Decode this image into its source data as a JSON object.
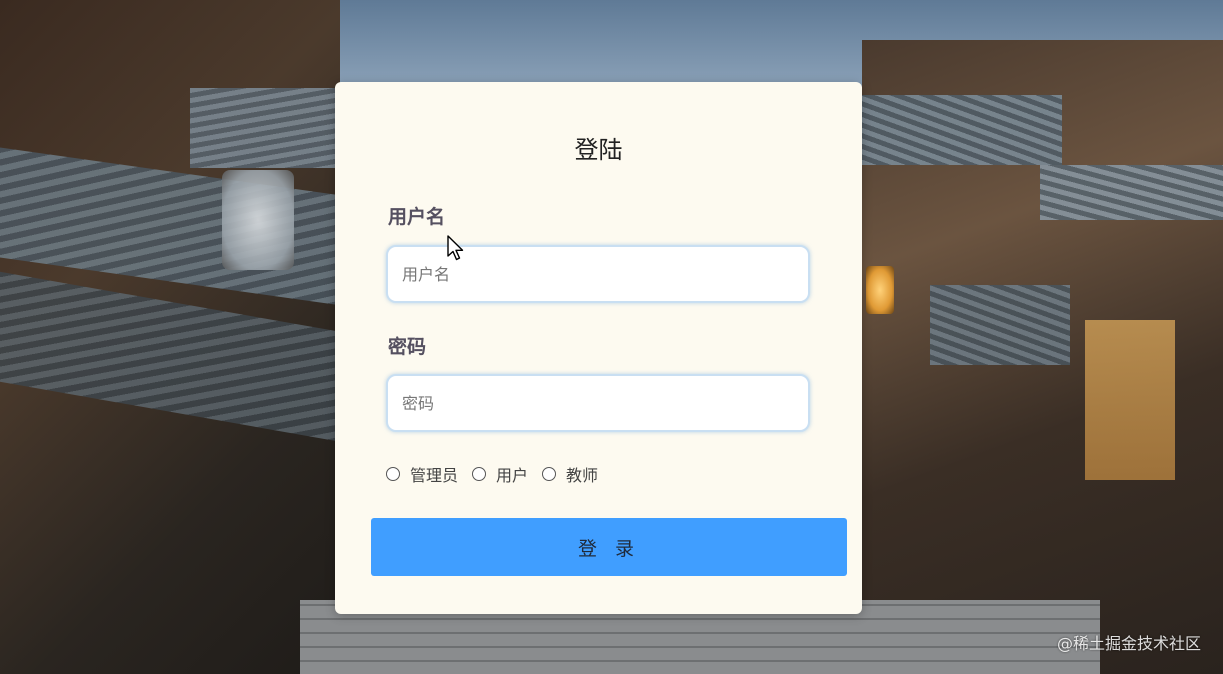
{
  "login": {
    "title": "登陆",
    "username_label": "用户名",
    "username_placeholder": "用户名",
    "password_label": "密码",
    "password_placeholder": "密码",
    "roles": [
      "管理员",
      "用户",
      "教师"
    ],
    "submit_label": "登 录"
  },
  "watermark": "@稀土掘金技术社区",
  "colors": {
    "card_background": "#fdfaf0",
    "button_background": "#409eff",
    "input_border": "#c9dff2"
  },
  "icons": {
    "cursor": "mouse-pointer-icon",
    "radio": "radio-unchecked-icon"
  }
}
